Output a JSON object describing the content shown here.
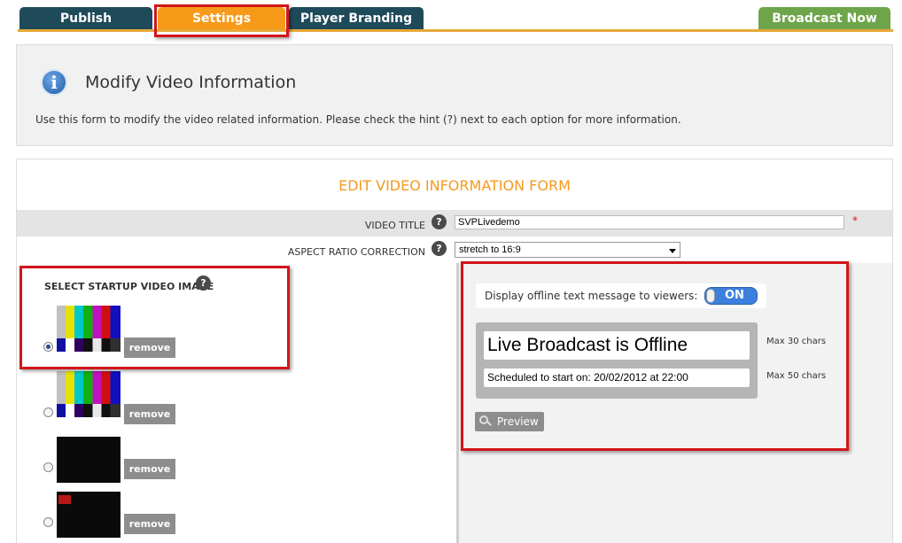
{
  "tabs": {
    "publish": "Publish",
    "settings": "Settings",
    "player_branding": "Player Branding",
    "broadcast_now": "Broadcast Now"
  },
  "info": {
    "icon": "info-icon",
    "title": "Modify Video Information",
    "description": "Use this form to modify the video related information. Please check the hint (?) next to each option for more information."
  },
  "form": {
    "title": "EDIT VIDEO INFORMATION FORM",
    "video_title_label": "VIDEO TITLE",
    "video_title_value": "SVPLivedemo",
    "required_mark": "*",
    "aspect_ratio_label": "ASPECT RATIO CORRECTION",
    "aspect_ratio_value": "stretch to 16:9",
    "help_glyph": "?"
  },
  "startup_images": {
    "label": "SELECT STARTUP VIDEO IMAGE",
    "remove_label": "remove",
    "selected_index": 0,
    "items": [
      {
        "type": "color-bars"
      },
      {
        "type": "color-bars"
      },
      {
        "type": "black-slide"
      },
      {
        "type": "black-slide-red"
      }
    ]
  },
  "offline": {
    "label": "Display offline text message to viewers:",
    "toggle": "ON",
    "title_value": "Live Broadcast is Offline",
    "title_max": "Max 30 chars",
    "subtitle_value": "Scheduled to start on: 20/02/2012 at 22:00",
    "subtitle_max": "Max 50 chars",
    "preview_label": "Preview"
  },
  "colors": {
    "accent_orange": "#f79a1a",
    "tab_dark": "#1f4a5a",
    "tab_green": "#6ea54a",
    "highlight_red": "#d2151a",
    "toggle_blue": "#3c7fdc"
  }
}
